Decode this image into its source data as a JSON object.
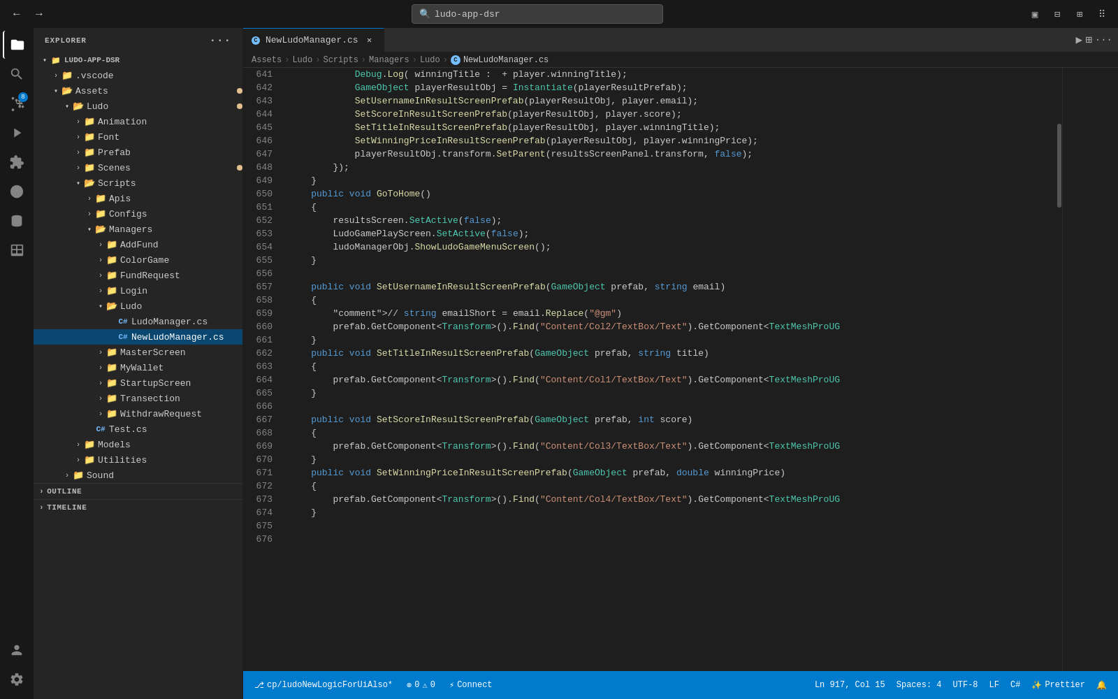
{
  "titlebar": {
    "search_placeholder": "ludo-app-dsr",
    "nav_back": "←",
    "nav_forward": "→"
  },
  "tabs": [
    {
      "name": "NewLudoManager.cs",
      "active": true,
      "icon": "C#",
      "modified": false
    }
  ],
  "breadcrumb": [
    "Assets",
    "Ludo",
    "Scripts",
    "Managers",
    "Ludo",
    "NewLudoManager.cs"
  ],
  "sidebar": {
    "title": "EXPLORER",
    "root": "LUDO-APP-DSR",
    "tree": [
      {
        "label": ".vscode",
        "indent": 1,
        "type": "folder",
        "open": false
      },
      {
        "label": "Assets",
        "indent": 1,
        "type": "folder",
        "open": true,
        "dot": "yellow"
      },
      {
        "label": "Ludo",
        "indent": 2,
        "type": "folder",
        "open": true,
        "dot": "yellow"
      },
      {
        "label": "Animation",
        "indent": 3,
        "type": "folder",
        "open": false
      },
      {
        "label": "Font",
        "indent": 3,
        "type": "folder",
        "open": false
      },
      {
        "label": "Prefab",
        "indent": 3,
        "type": "folder",
        "open": false
      },
      {
        "label": "Scenes",
        "indent": 3,
        "type": "folder",
        "open": false,
        "dot": "yellow"
      },
      {
        "label": "Scripts",
        "indent": 3,
        "type": "folder",
        "open": true
      },
      {
        "label": "Apis",
        "indent": 4,
        "type": "folder",
        "open": false
      },
      {
        "label": "Configs",
        "indent": 4,
        "type": "folder",
        "open": false
      },
      {
        "label": "Managers",
        "indent": 4,
        "type": "folder",
        "open": true
      },
      {
        "label": "AddFund",
        "indent": 5,
        "type": "folder",
        "open": false
      },
      {
        "label": "ColorGame",
        "indent": 5,
        "type": "folder",
        "open": false
      },
      {
        "label": "FundRequest",
        "indent": 5,
        "type": "folder",
        "open": false
      },
      {
        "label": "Login",
        "indent": 5,
        "type": "folder",
        "open": false
      },
      {
        "label": "Ludo",
        "indent": 5,
        "type": "folder",
        "open": true
      },
      {
        "label": "LudoManager.cs",
        "indent": 6,
        "type": "cs-file"
      },
      {
        "label": "NewLudoManager.cs",
        "indent": 6,
        "type": "cs-file",
        "active": true
      },
      {
        "label": "MasterScreen",
        "indent": 5,
        "type": "folder",
        "open": false
      },
      {
        "label": "MyWallet",
        "indent": 5,
        "type": "folder",
        "open": false
      },
      {
        "label": "StartupScreen",
        "indent": 5,
        "type": "folder",
        "open": false
      },
      {
        "label": "Transection",
        "indent": 5,
        "type": "folder",
        "open": false
      },
      {
        "label": "WithdrawRequest",
        "indent": 5,
        "type": "folder",
        "open": false
      },
      {
        "label": "Test.cs",
        "indent": 4,
        "type": "cs-file-plain"
      },
      {
        "label": "Models",
        "indent": 3,
        "type": "folder",
        "open": false
      },
      {
        "label": "Utilities",
        "indent": 3,
        "type": "folder",
        "open": false
      },
      {
        "label": "Sound",
        "indent": 2,
        "type": "folder",
        "open": false
      }
    ]
  },
  "outline": {
    "label": "OUTLINE"
  },
  "timeline": {
    "label": "TIMELINE"
  },
  "code_lines": [
    {
      "num": 641,
      "content": "            Debug.Log( winningTitle :  + player.winningTitle);"
    },
    {
      "num": 642,
      "content": "            GameObject playerResultObj = Instantiate(playerResultPrefab);"
    },
    {
      "num": 643,
      "content": "            SetUsernameInResultScreenPrefab(playerResultObj, player.email);"
    },
    {
      "num": 644,
      "content": "            SetScoreInResultScreenPrefab(playerResultObj, player.score);"
    },
    {
      "num": 645,
      "content": "            SetTitleInResultScreenPrefab(playerResultObj, player.winningTitle);"
    },
    {
      "num": 646,
      "content": "            SetWinningPriceInResultScreenPrefab(playerResultObj, player.winningPrice);"
    },
    {
      "num": 647,
      "content": "            playerResultObj.transform.SetParent(resultsScreenPanel.transform, false);"
    },
    {
      "num": 648,
      "content": "        });"
    },
    {
      "num": 649,
      "content": "    }"
    },
    {
      "num": 650,
      "content": "    public void GoToHome()"
    },
    {
      "num": 651,
      "content": "    {"
    },
    {
      "num": 652,
      "content": "        resultsScreen.SetActive(false);"
    },
    {
      "num": 653,
      "content": "        LudoGamePlayScreen.SetActive(false);"
    },
    {
      "num": 654,
      "content": "        ludoManagerObj.ShowLudoGameMenuScreen();"
    },
    {
      "num": 655,
      "content": "    }"
    },
    {
      "num": 656,
      "content": ""
    },
    {
      "num": 657,
      "content": "    public void SetUsernameInResultScreenPrefab(GameObject prefab, string email)"
    },
    {
      "num": 658,
      "content": "    {"
    },
    {
      "num": 659,
      "content": "        // string emailShort = email.Replace(\"@gm\")"
    },
    {
      "num": 660,
      "content": "        prefab.GetComponent<Transform>().Find(\"Content/Col2/TextBox/Text\").GetComponent<TextMeshProUG"
    },
    {
      "num": 661,
      "content": "    }"
    },
    {
      "num": 662,
      "content": "    public void SetTitleInResultScreenPrefab(GameObject prefab, string title)"
    },
    {
      "num": 663,
      "content": "    {"
    },
    {
      "num": 664,
      "content": "        prefab.GetComponent<Transform>().Find(\"Content/Col1/TextBox/Text\").GetComponent<TextMeshProUG"
    },
    {
      "num": 665,
      "content": "    }"
    },
    {
      "num": 666,
      "content": ""
    },
    {
      "num": 667,
      "content": "    public void SetScoreInResultScreenPrefab(GameObject prefab, int score)"
    },
    {
      "num": 668,
      "content": "    {"
    },
    {
      "num": 669,
      "content": "        prefab.GetComponent<Transform>().Find(\"Content/Col3/TextBox/Text\").GetComponent<TextMeshProUG"
    },
    {
      "num": 670,
      "content": "    }"
    },
    {
      "num": 671,
      "content": "    public void SetWinningPriceInResultScreenPrefab(GameObject prefab, double winningPrice)"
    },
    {
      "num": 672,
      "content": "    {"
    },
    {
      "num": 673,
      "content": "        prefab.GetComponent<Transform>().Find(\"Content/Col4/TextBox/Text\").GetComponent<TextMeshProUG"
    },
    {
      "num": 674,
      "content": "    }"
    },
    {
      "num": 675,
      "content": ""
    },
    {
      "num": 676,
      "content": ""
    }
  ],
  "status_bar": {
    "branch": "cp/ludoNewLogicForUiAlso*",
    "errors": "0",
    "warnings": "0",
    "connect": "Connect",
    "ln": "Ln 917, Col 15",
    "spaces": "Spaces: 4",
    "encoding": "UTF-8",
    "eol": "LF",
    "lang": "C#",
    "prettier": "Prettier"
  }
}
